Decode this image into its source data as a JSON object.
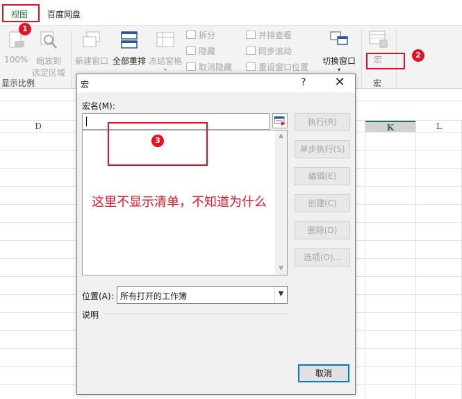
{
  "ribbon": {
    "tabs": [
      {
        "label": "视图",
        "active": true
      },
      {
        "label": "百度网盘",
        "active": false
      }
    ],
    "zoom_group": {
      "btn_100": "100%",
      "btn_zoom_selection_1": "缩放到",
      "btn_zoom_selection_2": "选定区域",
      "label": "显示比例"
    },
    "window_group": {
      "new_window": "新建窗口",
      "arrange_all": "全部重排",
      "freeze_panes": "冻结窗格",
      "split": "拆分",
      "hide": "隐藏",
      "unhide": "取消隐藏",
      "view_side_by_side": "并排查看",
      "sync_scroll": "同步滚动",
      "reset_position": "重设窗口位置",
      "switch_windows": "切换窗口"
    },
    "macro_group": {
      "macros": "宏",
      "label": "宏"
    }
  },
  "sheet": {
    "columns": [
      {
        "label": "D",
        "selected": false
      },
      {
        "label": "K",
        "selected": true
      },
      {
        "label": "L",
        "selected": false
      }
    ]
  },
  "dialog": {
    "title": "宏",
    "help": "?",
    "close": "✕",
    "macro_name_label": "宏名(M):",
    "macro_name_value": "",
    "buttons": {
      "run": "执行(R)",
      "step_into": "单步执行(S)",
      "edit": "编辑(E)",
      "create": "创建(C)",
      "delete": "删除(D)",
      "options": "选项(O)...",
      "cancel": "取消"
    },
    "location_label": "位置(A):",
    "location_value": "所有打开的工作簿",
    "description_label": "说明"
  },
  "annotations": {
    "badge_1": "1",
    "badge_2": "2",
    "badge_3": "3",
    "note": "这里不显示清单，不知道为什么",
    "color": "#e81123"
  }
}
